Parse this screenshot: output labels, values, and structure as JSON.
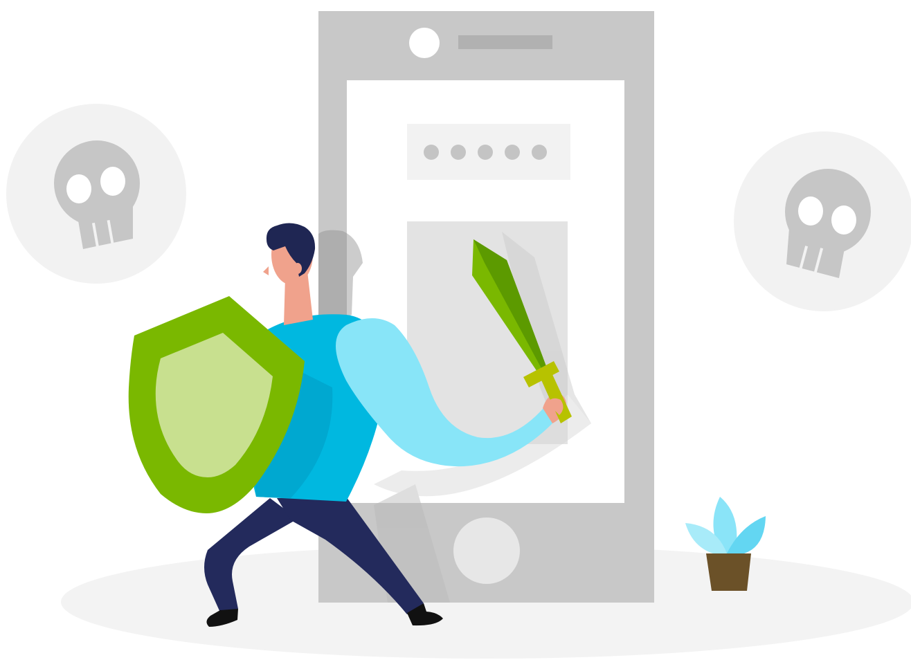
{
  "illustration": {
    "subject": "person-defending-phone",
    "phone": {
      "password_dots": 5
    },
    "threat_icons": [
      "skull-icon",
      "skull-icon"
    ],
    "decor_icons": [
      "plant-icon"
    ]
  },
  "colors": {
    "ground": "#f3f3f3",
    "phone_body": "#c8c8c8",
    "phone_dark": "#b1b1b1",
    "screen": "#ffffff",
    "screen_panel": "#f2f2f2",
    "screen_card": "#e3e3e3",
    "dots": "#c4c4c4",
    "skull_bg": "#f2f2f2",
    "skull": "#c6c6c6",
    "shield_outer": "#7ab800",
    "shield_inner": "#c8e08f",
    "sword_blade": "#7ab800",
    "sword_dark": "#5c9a00",
    "sword_guard": "#b7c200",
    "shirt": "#00b8e0",
    "shirt_shade": "#00a8d0",
    "sleeve": "#88e5f8",
    "pants": "#232a5c",
    "hair": "#1f2653",
    "skin": "#f0a28c",
    "shoe": "#111111",
    "pot": "#6b5128",
    "leaf": "#8ae4f8",
    "leaf_dark": "#63d6f2"
  }
}
